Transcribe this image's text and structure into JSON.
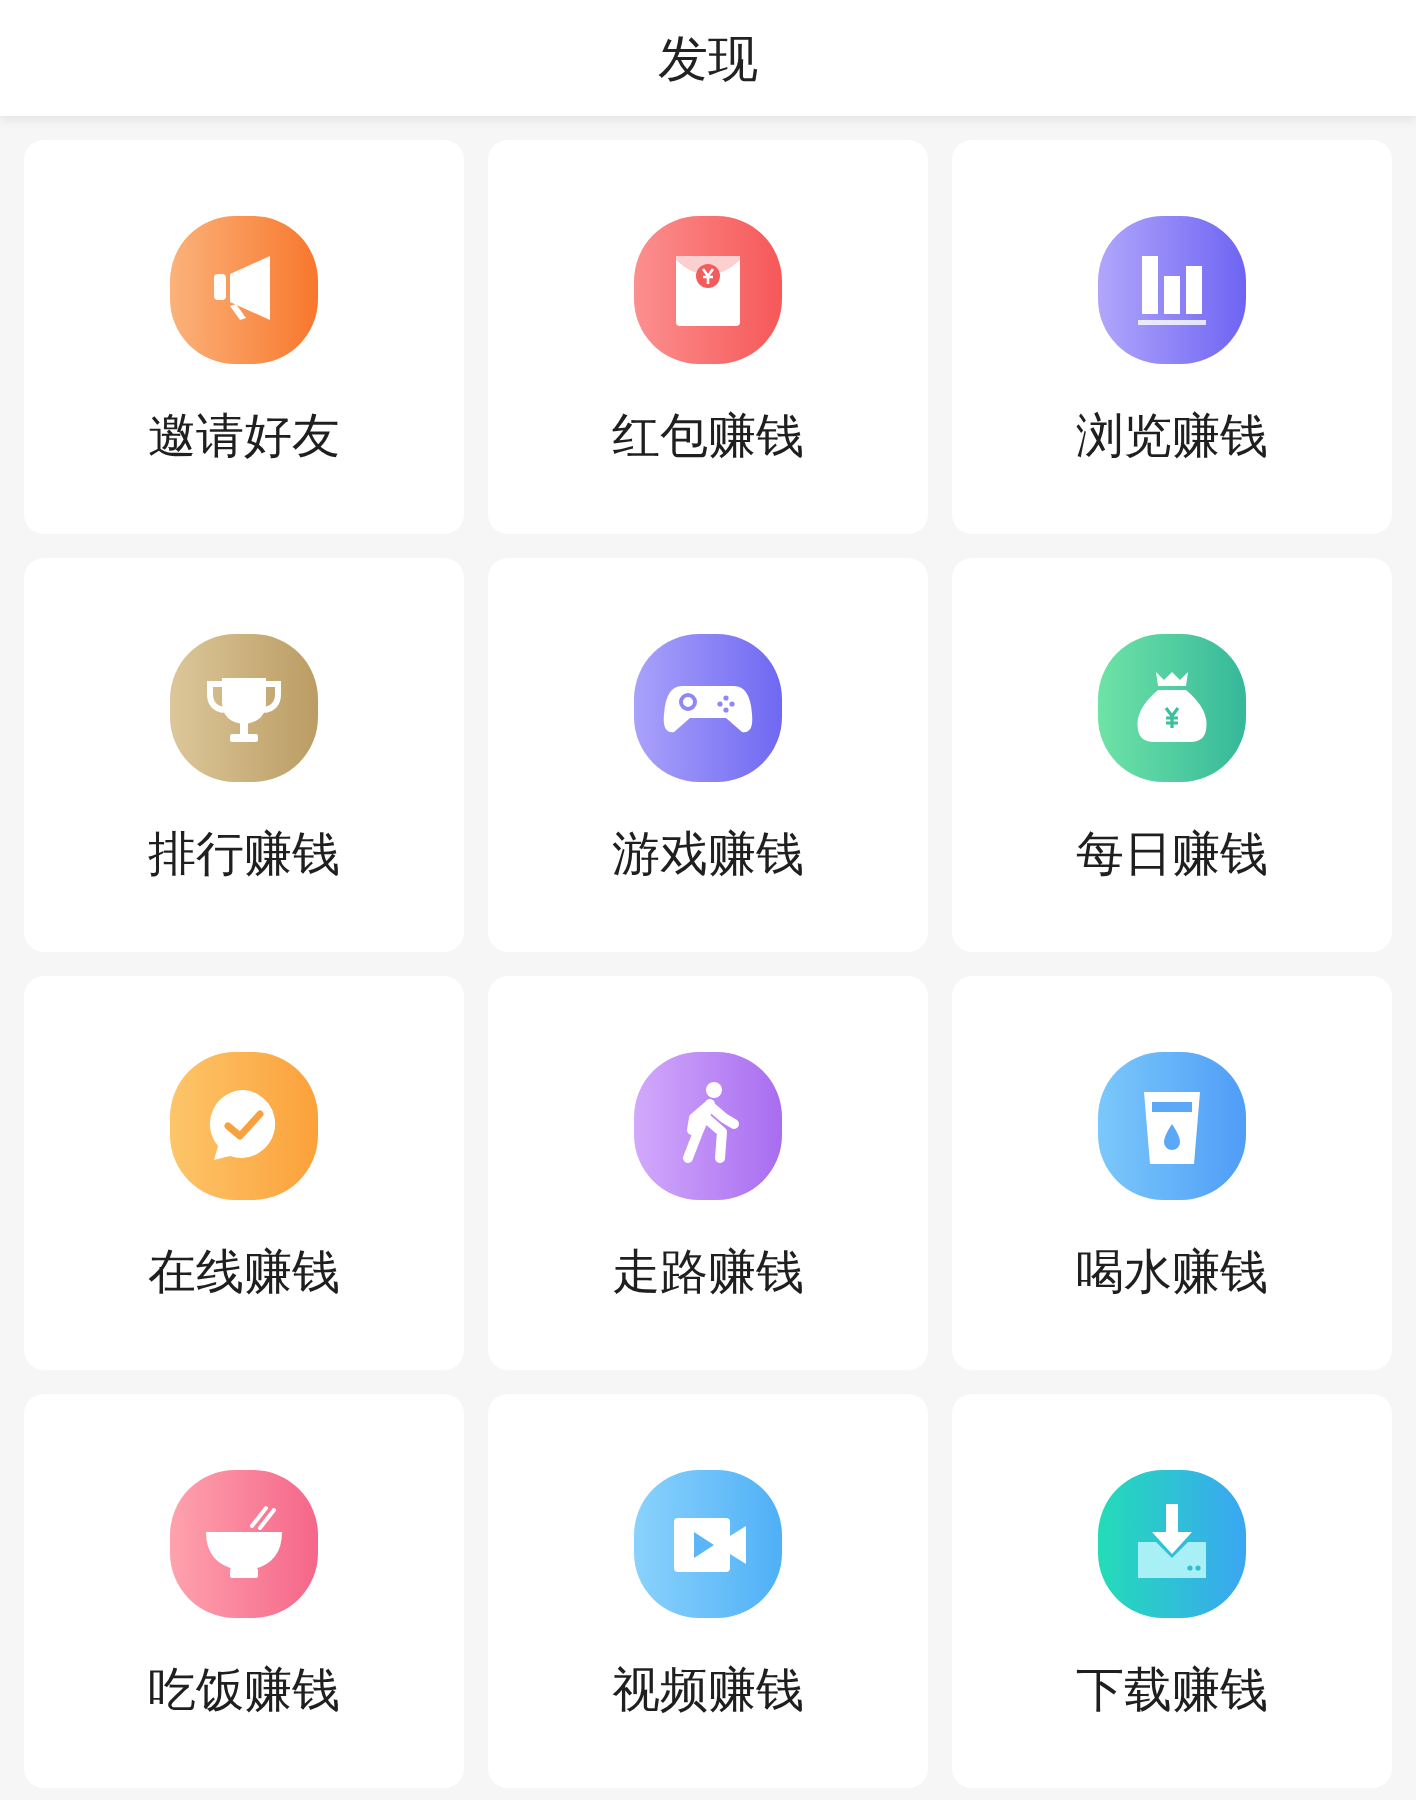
{
  "header": {
    "title": "发现"
  },
  "items": [
    {
      "label": "邀请好友",
      "kind": "megaphone"
    },
    {
      "label": "红包赚钱",
      "kind": "envelope"
    },
    {
      "label": "浏览赚钱",
      "kind": "chart"
    },
    {
      "label": "排行赚钱",
      "kind": "trophy"
    },
    {
      "label": "游戏赚钱",
      "kind": "gamepad"
    },
    {
      "label": "每日赚钱",
      "kind": "moneybag"
    },
    {
      "label": "在线赚钱",
      "kind": "chat"
    },
    {
      "label": "走路赚钱",
      "kind": "walker"
    },
    {
      "label": "喝水赚钱",
      "kind": "cup"
    },
    {
      "label": "吃饭赚钱",
      "kind": "bowl"
    },
    {
      "label": "视频赚钱",
      "kind": "video"
    },
    {
      "label": "下载赚钱",
      "kind": "download"
    }
  ]
}
